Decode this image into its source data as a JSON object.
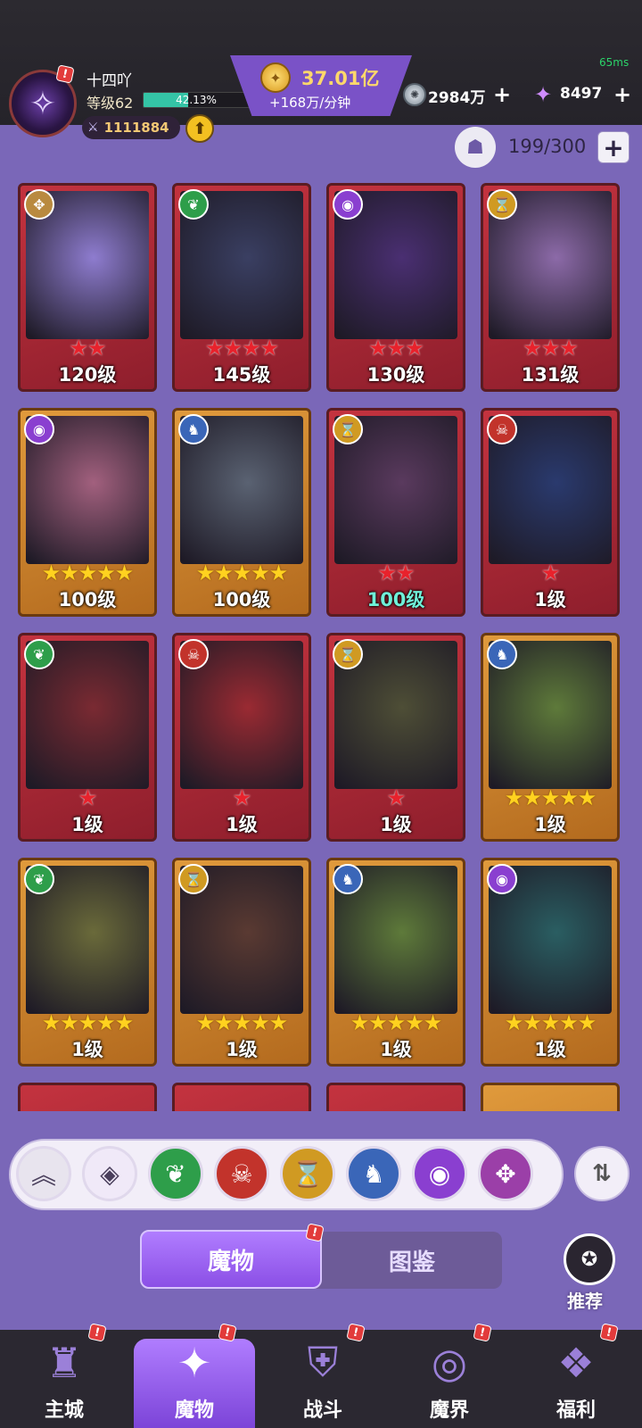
{
  "header": {
    "player_name": "十四吖",
    "level": "等级62",
    "exp_percent": "42.13%",
    "exp_fraction": 0.4213,
    "power": "1111884",
    "gold_amount": "37.01亿",
    "gold_rate": "+168万/分钟",
    "silver": "2984万",
    "gems": "8497",
    "ping": "65ms"
  },
  "capacity": {
    "text": "199/300"
  },
  "cards": [
    {
      "element": "wind-icon",
      "element_color": "#b98a3f",
      "frame": "red",
      "stars": 2,
      "star_color": "red",
      "level": "120级",
      "art": "#8e7ccf"
    },
    {
      "element": "leaf-icon",
      "element_color": "#2e9e4a",
      "frame": "red",
      "stars": 4,
      "star_color": "red",
      "level": "145级",
      "art": "#3a3f62"
    },
    {
      "element": "eye-icon",
      "element_color": "#8a3fd0",
      "frame": "red",
      "stars": 3,
      "star_color": "red",
      "level": "130级",
      "art": "#4a2f72"
    },
    {
      "element": "hourglass-icon",
      "element_color": "#d09a22",
      "frame": "red",
      "stars": 3,
      "star_color": "red",
      "level": "131级",
      "art": "#8c6aa8"
    },
    {
      "element": "eye-icon",
      "element_color": "#8a3fd0",
      "frame": "gold",
      "stars": 5,
      "star_color": "gold",
      "level": "100级",
      "art": "#a2607e"
    },
    {
      "element": "wolf-icon",
      "element_color": "#3a66b8",
      "frame": "gold",
      "stars": 5,
      "star_color": "gold",
      "level": "100级",
      "art": "#5a6272"
    },
    {
      "element": "hourglass-icon",
      "element_color": "#d09a22",
      "frame": "red",
      "stars": 2,
      "star_color": "red",
      "level": "100级",
      "art": "#5a3a5e",
      "level_teal": true
    },
    {
      "element": "demon-icon",
      "element_color": "#c2332b",
      "frame": "red",
      "stars": 1,
      "star_color": "red",
      "level": "1级",
      "art": "#2a3a6e"
    },
    {
      "element": "leaf-icon",
      "element_color": "#2e9e4a",
      "frame": "red",
      "stars": 1,
      "star_color": "red",
      "level": "1级",
      "art": "#7a2a32"
    },
    {
      "element": "demon-icon",
      "element_color": "#c2332b",
      "frame": "red",
      "stars": 1,
      "star_color": "red",
      "level": "1级",
      "art": "#9a2a32"
    },
    {
      "element": "hourglass-icon",
      "element_color": "#d09a22",
      "frame": "red",
      "stars": 1,
      "star_color": "red",
      "level": "1级",
      "art": "#4e4e36"
    },
    {
      "element": "wolf-icon",
      "element_color": "#3a66b8",
      "frame": "gold",
      "stars": 5,
      "star_color": "gold",
      "level": "1级",
      "art": "#5e7a3a"
    },
    {
      "element": "leaf-icon",
      "element_color": "#2e9e4a",
      "frame": "gold",
      "stars": 5,
      "star_color": "gold",
      "level": "1级",
      "art": "#6a6a3a"
    },
    {
      "element": "hourglass-icon",
      "element_color": "#d09a22",
      "frame": "gold",
      "stars": 5,
      "star_color": "gold",
      "level": "1级",
      "art": "#5a3a32"
    },
    {
      "element": "wolf-icon",
      "element_color": "#3a66b8",
      "frame": "gold",
      "stars": 5,
      "star_color": "gold",
      "level": "1级",
      "art": "#5e7a3a"
    },
    {
      "element": "eye-icon",
      "element_color": "#8a3fd0",
      "frame": "gold",
      "stars": 5,
      "star_color": "gold",
      "level": "1级",
      "art": "#2a5e62"
    }
  ],
  "filters": [
    {
      "name": "collapse",
      "glyph": "︽",
      "color": "#e8e4ee"
    },
    {
      "name": "all",
      "glyph": "◈",
      "color": "#f0e9f8"
    },
    {
      "name": "leaf",
      "glyph": "❦",
      "color": "#2e9e4a"
    },
    {
      "name": "demon",
      "glyph": "☠",
      "color": "#c2332b"
    },
    {
      "name": "hourglass",
      "glyph": "⌛",
      "color": "#d09a22"
    },
    {
      "name": "wolf",
      "glyph": "♞",
      "color": "#3a66b8"
    },
    {
      "name": "eye",
      "glyph": "◉",
      "color": "#8a3fd0"
    },
    {
      "name": "wind",
      "glyph": "✥",
      "color": "#9b3fa8"
    }
  ],
  "tabs": {
    "monster": "魔物",
    "codex": "图鉴"
  },
  "recommend_label": "推荐",
  "nav": [
    {
      "label": "主城",
      "icon": "castle-icon",
      "glyph": "♜"
    },
    {
      "label": "魔物",
      "icon": "monster-icon",
      "glyph": "✦"
    },
    {
      "label": "战斗",
      "icon": "shield-icon",
      "glyph": "⛨"
    },
    {
      "label": "魔界",
      "icon": "portal-icon",
      "glyph": "◎"
    },
    {
      "label": "福利",
      "icon": "chest-icon",
      "glyph": "❖"
    }
  ]
}
